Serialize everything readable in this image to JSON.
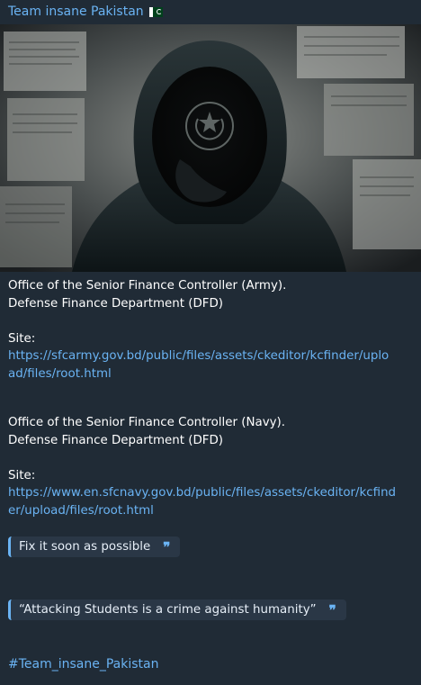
{
  "message": {
    "sender": "Team insane Pakistan",
    "flag_icon": "pakistan-flag-icon",
    "photo_icon": "hooded-hacker-newspaper-image",
    "target1": {
      "line1": "Office of the Senior Finance Controller (Army).",
      "line2": "Defense Finance Department (DFD)",
      "site_label": "Site:",
      "url_line1": "https://sfcarmy.gov.bd/public/files/assets/ckeditor/kcfinder/uplo",
      "url_line2": "ad/files/root.html"
    },
    "target2": {
      "line1": "Office of the Senior Finance Controller (Navy).",
      "line2": "Defense Finance Department (DFD)",
      "site_label": "Site:",
      "url_line1": "https://www.en.sfcnavy.gov.bd/public/files/assets/ckeditor/kcfind",
      "url_line2": "er/upload/files/root.html"
    },
    "quote1": "Fix it soon as possible",
    "quote2": "“Attacking Students is a crime against humanity”",
    "quote_icon": "quote-marks-icon",
    "hashtag": "#Team_insane_Pakistan"
  },
  "colors": {
    "background": "#202b36",
    "link": "#6ab3f3",
    "quote_bg": "#2a3746"
  }
}
